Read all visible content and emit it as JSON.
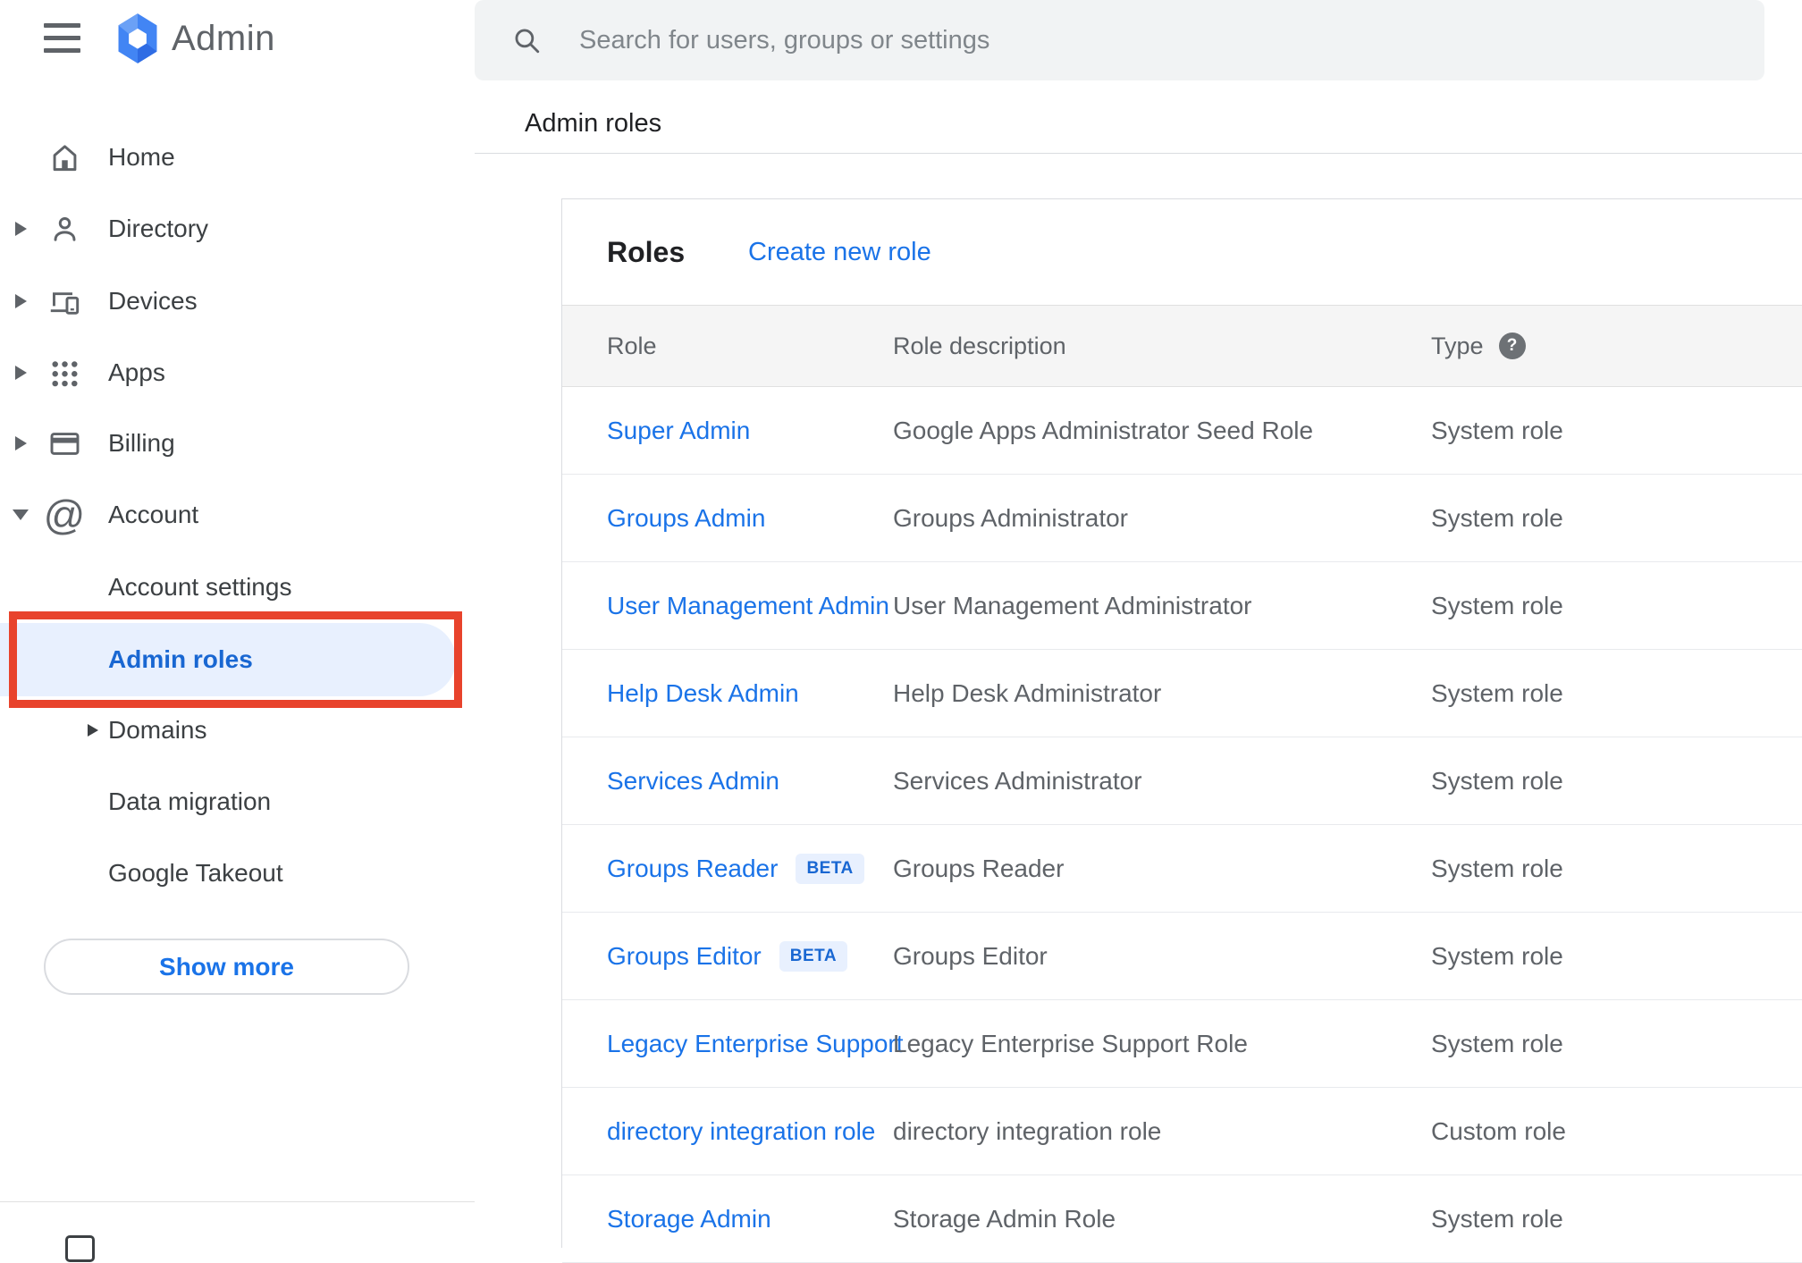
{
  "app": {
    "logo_text": "Admin"
  },
  "topbar": {
    "search_placeholder": "Search for users, groups or settings"
  },
  "breadcrumb": "Admin roles",
  "sidebar": {
    "items": [
      {
        "label": "Home"
      },
      {
        "label": "Directory"
      },
      {
        "label": "Devices"
      },
      {
        "label": "Apps"
      },
      {
        "label": "Billing"
      },
      {
        "label": "Account"
      }
    ],
    "account_children": [
      {
        "label": "Account settings"
      },
      {
        "label": "Admin roles",
        "active": true
      },
      {
        "label": "Domains"
      },
      {
        "label": "Data migration"
      },
      {
        "label": "Google Takeout"
      }
    ],
    "show_more_label": "Show more"
  },
  "roles_card": {
    "title": "Roles",
    "create_link": "Create new role",
    "beta_label": "BETA",
    "columns": {
      "role": "Role",
      "description": "Role description",
      "type": "Type"
    },
    "help_glyph": "?",
    "rows": [
      {
        "role": "Super Admin",
        "beta": false,
        "description": "Google Apps Administrator Seed Role",
        "type": "System role"
      },
      {
        "role": "Groups Admin",
        "beta": false,
        "description": "Groups Administrator",
        "type": "System role"
      },
      {
        "role": "User Management Admin",
        "beta": false,
        "description": "User Management Administrator",
        "type": "System role"
      },
      {
        "role": "Help Desk Admin",
        "beta": false,
        "description": "Help Desk Administrator",
        "type": "System role"
      },
      {
        "role": "Services Admin",
        "beta": false,
        "description": "Services Administrator",
        "type": "System role"
      },
      {
        "role": "Groups Reader",
        "beta": true,
        "description": "Groups Reader",
        "type": "System role"
      },
      {
        "role": "Groups Editor",
        "beta": true,
        "description": "Groups Editor",
        "type": "System role"
      },
      {
        "role": "Legacy Enterprise Support",
        "beta": false,
        "description": "Legacy Enterprise Support Role",
        "type": "System role"
      },
      {
        "role": "directory integration role",
        "beta": false,
        "description": "directory integration role",
        "type": "Custom role"
      },
      {
        "role": "Storage Admin",
        "beta": false,
        "description": "Storage Admin Role",
        "type": "System role"
      }
    ]
  },
  "colors": {
    "link_blue": "#1a73e8",
    "active_nav_blue": "#1967d2",
    "active_pill_bg": "#e8f0fe",
    "annotation_red": "#e8432c",
    "table_header_bg": "#f5f5f5",
    "searchbar_bg": "#f1f3f4",
    "logo_blue": "#4285f4",
    "icon_gray": "#5f6368"
  }
}
